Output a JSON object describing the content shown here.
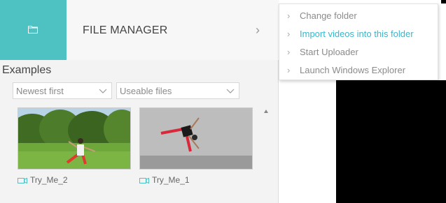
{
  "header": {
    "title": "FILE MANAGER",
    "folder_icon": "folder-icon",
    "chevron_icon": "chevron-right-icon",
    "accent_color": "#4ec1c2"
  },
  "section": {
    "title": "Examples"
  },
  "filters": {
    "sort": {
      "value": "Newest first"
    },
    "type": {
      "value": "Useable files"
    }
  },
  "videos": [
    {
      "name": "Try_Me_2",
      "icon": "video-file-icon"
    },
    {
      "name": "Try_Me_1",
      "icon": "video-file-icon"
    }
  ],
  "menu": {
    "items": [
      {
        "label": "Change folder"
      },
      {
        "label": "Import videos into this folder",
        "highlight_color": "#3bb6c9"
      },
      {
        "label": "Start Uploader"
      },
      {
        "label": "Launch Windows Explorer"
      }
    ]
  }
}
